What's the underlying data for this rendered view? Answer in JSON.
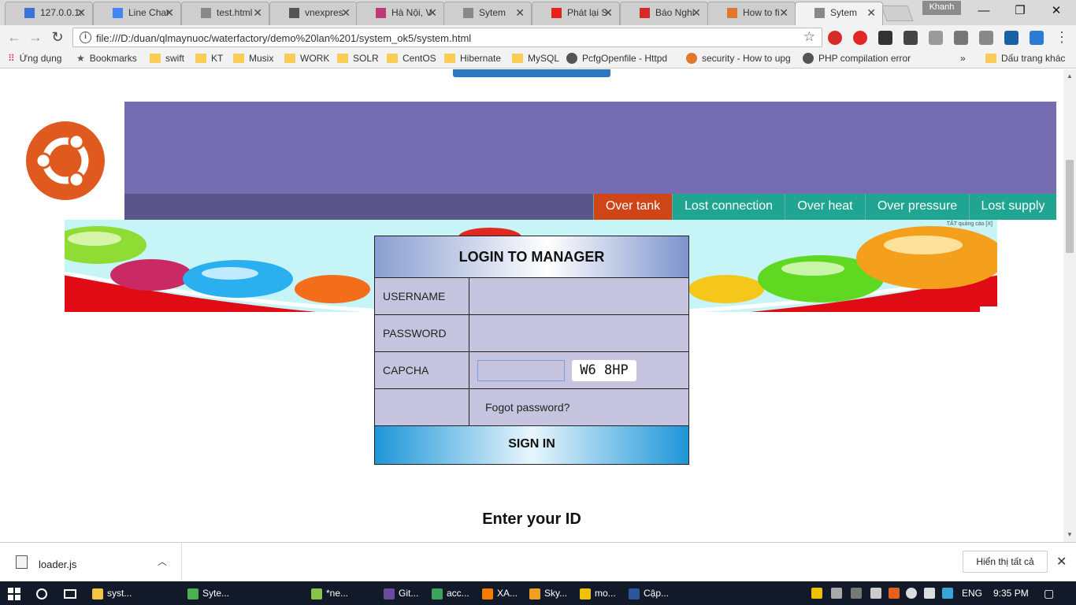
{
  "browser": {
    "tabs": [
      {
        "label": "127.0.0.1:",
        "color": "#3b73d8"
      },
      {
        "label": "Line Char",
        "color": "#4285f4"
      },
      {
        "label": "test.html",
        "color": "#888888"
      },
      {
        "label": "vnexpres",
        "color": "#555555"
      },
      {
        "label": "Hà Nội, V",
        "color": "#c03a7a"
      },
      {
        "label": "Sytem",
        "color": "#888888"
      },
      {
        "label": "Phát lại S",
        "color": "#e62117"
      },
      {
        "label": "Báo Nghi",
        "color": "#d42a2a"
      },
      {
        "label": "How to fi",
        "color": "#e0782d"
      },
      {
        "label": "Sytem",
        "color": "#888888"
      }
    ],
    "profile": "Khanh",
    "url": "file:///D:/duan/qlmaynuoc/waterfactory/demo%20lan%201/system_ok5/system.html",
    "bookmarks": [
      {
        "label": "Ứng dụng",
        "icon": "apps-grid-icon"
      },
      {
        "label": "Bookmarks",
        "icon": "star-icon"
      },
      {
        "label": "swift",
        "icon": "folder-icon"
      },
      {
        "label": "KT",
        "icon": "folder-icon"
      },
      {
        "label": "Musix",
        "icon": "folder-icon"
      },
      {
        "label": "WORK",
        "icon": "folder-icon"
      },
      {
        "label": "SOLR",
        "icon": "folder-icon"
      },
      {
        "label": "CentOS",
        "icon": "folder-icon"
      },
      {
        "label": "Hibernate",
        "icon": "folder-icon"
      },
      {
        "label": "MySQL",
        "icon": "folder-icon"
      },
      {
        "label": "PcfgOpenfile - Httpd",
        "icon": "wordpress-icon"
      },
      {
        "label": "security - How to upg",
        "icon": "stackoverflow-icon"
      },
      {
        "label": "PHP compilation error",
        "icon": "wordpress-icon"
      }
    ],
    "bookmarks_more": "»",
    "other_bookmarks": "Dấu trang khác"
  },
  "page": {
    "alerts": [
      {
        "label": "Over tank",
        "color": "#cf4517"
      },
      {
        "label": "Lost connection",
        "color": "#21a593"
      },
      {
        "label": "Over heat",
        "color": "#21a593"
      },
      {
        "label": "Over pressure",
        "color": "#21a593"
      },
      {
        "label": "Lost supply",
        "color": "#21a593"
      }
    ],
    "banner_ad_text": "TẮT quảng cáo [X]",
    "login": {
      "title": "LOGIN TO MANAGER",
      "username_label": "USERNAME",
      "password_label": "PASSWORD",
      "captcha_label": "CAPCHA",
      "captcha_code": "W6 8HP",
      "forgot": "Fogot password?",
      "signin": "SIGN IN"
    },
    "enter_id": "Enter your ID"
  },
  "downloads": {
    "file": "loader.js",
    "show_all": "Hiển thị tất cả"
  },
  "taskbar": {
    "items": [
      {
        "label": "syst...",
        "color": "#f4c542"
      },
      {
        "label": "Syte...",
        "color": "#4caf50"
      },
      {
        "label": "*ne...",
        "color": "#8bc34a"
      },
      {
        "label": "Git...",
        "color": "#6a4c9c"
      },
      {
        "label": "acc...",
        "color": "#3ba55c"
      },
      {
        "label": "XA...",
        "color": "#f57c00"
      },
      {
        "label": "Sky...",
        "color": "#f0a020"
      },
      {
        "label": "mo...",
        "color": "#f2c200"
      },
      {
        "label": "Cập...",
        "color": "#2b579a"
      }
    ],
    "lang": "ENG",
    "time": "9:35 PM"
  }
}
